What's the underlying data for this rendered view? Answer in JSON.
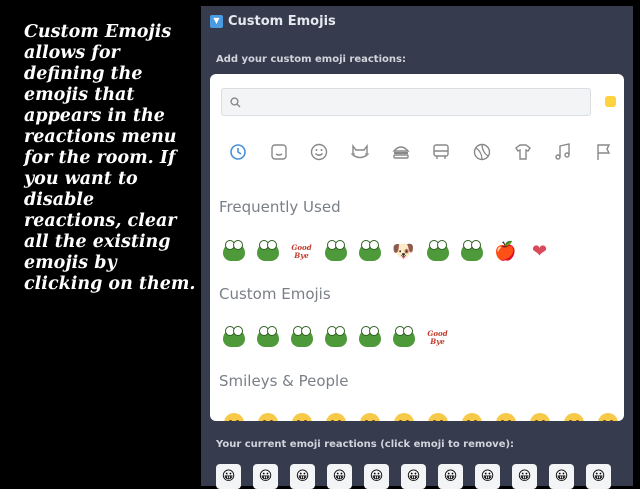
{
  "caption": "Custom Emojis allows for defining the emojis that appears in the reactions menu for the room. If you want to disable reactions, clear all the existing emojis by clicking on them.",
  "panel": {
    "title": "Custom Emojis",
    "toggle_glyph": "▼",
    "instruction": "Add your custom emoji reactions:",
    "current_label": "Your current emoji reactions (click emoji to remove):"
  },
  "picker": {
    "search": {
      "placeholder": "",
      "value": ""
    },
    "skin_tone_color": "#ffd33d",
    "categories": [
      "recent-icon",
      "smileys-icon",
      "people-icon",
      "animals-icon",
      "food-icon",
      "travel-icon",
      "activity-icon",
      "objects-icon",
      "symbols-icon",
      "flags-icon"
    ],
    "sections": [
      {
        "title": "Frequently Used",
        "emojis": [
          "pepe-emoji",
          "frog-emoji",
          "goodbye-emoji",
          "pepe-emoji",
          "pepe-emoji",
          "dog-emoji",
          "pepe-emoji",
          "pepe-emoji",
          "apple-emoji",
          "heart-emoji"
        ]
      },
      {
        "title": "Custom Emojis",
        "emojis": [
          "pepe-emoji",
          "pepe-emoji",
          "pepe-emoji",
          "pepe-emoji",
          "frog-emoji",
          "pepe-emoji",
          "goodbye-emoji"
        ]
      },
      {
        "title": "Smileys & People",
        "emojis": [
          "smiley-emoji",
          "smiley-emoji",
          "smiley-emoji",
          "smiley-emoji",
          "smiley-emoji",
          "smiley-emoji",
          "smiley-emoji",
          "smiley-emoji",
          "smiley-emoji",
          "smiley-emoji",
          "smiley-emoji",
          "smiley-emoji"
        ]
      }
    ],
    "goodbye_text": "Good Bye"
  },
  "current_reactions": [
    "reaction-emoji",
    "reaction-emoji",
    "reaction-emoji",
    "reaction-emoji",
    "reaction-emoji",
    "reaction-emoji",
    "reaction-emoji",
    "reaction-emoji",
    "reaction-emoji",
    "reaction-emoji",
    "reaction-emoji"
  ]
}
